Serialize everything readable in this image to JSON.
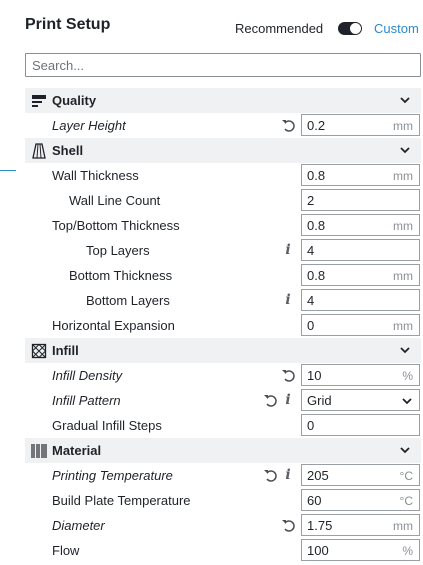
{
  "header": {
    "title": "Print Setup",
    "mode_recommended": "Recommended",
    "mode_custom": "Custom",
    "mode_toggle_on": true
  },
  "search": {
    "placeholder": "Search..."
  },
  "categories": {
    "quality": {
      "label": "Quality",
      "icon": "quality-icon",
      "settings": [
        {
          "label": "Layer Height",
          "value": "0.2",
          "unit": "mm",
          "italic": true,
          "reset": true,
          "info": false
        }
      ]
    },
    "shell": {
      "label": "Shell",
      "icon": "shell-icon",
      "settings": [
        {
          "label": "Wall Thickness",
          "value": "0.8",
          "unit": "mm"
        },
        {
          "label": "Wall Line Count",
          "value": "2",
          "unit": ""
        },
        {
          "label": "Top/Bottom Thickness",
          "value": "0.8",
          "unit": "mm"
        },
        {
          "label": "Top Layers",
          "value": "4",
          "unit": "",
          "info": true
        },
        {
          "label": "Bottom Thickness",
          "value": "0.8",
          "unit": "mm"
        },
        {
          "label": "Bottom Layers",
          "value": "4",
          "unit": "",
          "info": true
        },
        {
          "label": "Horizontal Expansion",
          "value": "0",
          "unit": "mm"
        }
      ]
    },
    "infill": {
      "label": "Infill",
      "icon": "infill-icon",
      "settings": [
        {
          "label": "Infill Density",
          "value": "10",
          "unit": "%",
          "italic": true,
          "reset": true
        },
        {
          "label": "Infill Pattern",
          "value": "Grid",
          "unit": "",
          "italic": true,
          "reset": true,
          "info": true,
          "dropdown": true
        },
        {
          "label": "Gradual Infill Steps",
          "value": "0",
          "unit": ""
        }
      ]
    },
    "material": {
      "label": "Material",
      "icon": "material-icon",
      "settings": [
        {
          "label": "Printing Temperature",
          "value": "205",
          "unit": "°C",
          "italic": true,
          "reset": true,
          "info": true
        },
        {
          "label": "Build Plate Temperature",
          "value": "60",
          "unit": "°C"
        },
        {
          "label": "Diameter",
          "value": "1.75",
          "unit": "mm",
          "italic": true,
          "reset": true
        },
        {
          "label": "Flow",
          "value": "100",
          "unit": "%"
        }
      ]
    }
  },
  "colors": {
    "accent": "#2a8bc9",
    "text": "#1f2329",
    "category_bg": "#f0f1f3"
  }
}
